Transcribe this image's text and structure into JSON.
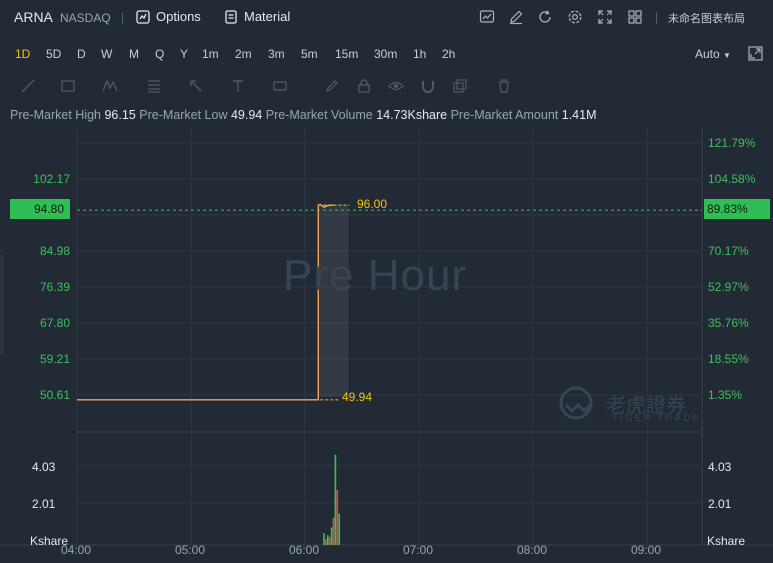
{
  "header": {
    "symbol": "ARNA",
    "exchange": "NASDAQ",
    "separator": "|",
    "options_label": "Options",
    "material_label": "Material",
    "layout_label": "未命名图表布局"
  },
  "periods": {
    "items": [
      "1D",
      "5D",
      "D",
      "W",
      "M",
      "Q",
      "Y",
      "1m",
      "2m",
      "3m",
      "5m",
      "15m",
      "30m",
      "1h",
      "2h"
    ],
    "active": "1D",
    "scale_label": "Auto"
  },
  "stats": {
    "high_label": "Pre-Market High",
    "high_value": "96.15",
    "low_label": "Pre-Market Low",
    "low_value": "49.94",
    "volume_label": "Pre-Market Volume",
    "volume_value": "14.73Kshare",
    "amount_label": "Pre-Market Amount",
    "amount_value": "1.41M"
  },
  "colors": {
    "up": "#3ec05a",
    "down": "#e5484d",
    "price_line": "#f2a65a",
    "marker": "#f0c419",
    "background": "#222a35"
  },
  "watermark": {
    "session_text": "Pre Hour",
    "brand_cn": "老虎證券",
    "brand_en": "TIGER TRADE"
  },
  "chart_data": {
    "type": "line",
    "price_axis_left": [
      "102.17",
      "94.80",
      "84.98",
      "76.39",
      "67.80",
      "59.21",
      "50.61"
    ],
    "price_axis_right": [
      "121.79%",
      "104.58%",
      "89.83%",
      "70.17%",
      "52.97%",
      "35.76%",
      "18.55%",
      "1.35%"
    ],
    "current_price": "94.80",
    "current_pct": "89.83%",
    "high_marker": "96.00",
    "low_marker": "49.94",
    "x_ticks": [
      "04:00",
      "05:00",
      "06:00",
      "07:00",
      "08:00",
      "09:00"
    ],
    "volume_axis_left": [
      "4.03",
      "2.01",
      "Kshare"
    ],
    "volume_axis_right": [
      "4.03",
      "2.01",
      "Kshare"
    ],
    "ylim": [
      50.61,
      102.17
    ],
    "price_series": {
      "x": [
        "04:00",
        "06:07",
        "06:07",
        "06:08",
        "06:10",
        "06:12",
        "06:15"
      ],
      "y": [
        49.94,
        49.94,
        96.0,
        96.15,
        95.5,
        95.9,
        96.0
      ]
    },
    "volume_series": {
      "x": [
        "06:08",
        "06:09",
        "06:10",
        "06:11",
        "06:12",
        "06:13",
        "06:14",
        "06:15",
        "06:16"
      ],
      "values": [
        0.6,
        0.3,
        0.5,
        0.4,
        0.9,
        1.4,
        4.6,
        2.8,
        1.6
      ],
      "direction": [
        "up",
        "down",
        "up",
        "down",
        "up",
        "down",
        "up",
        "down",
        "up"
      ]
    }
  }
}
